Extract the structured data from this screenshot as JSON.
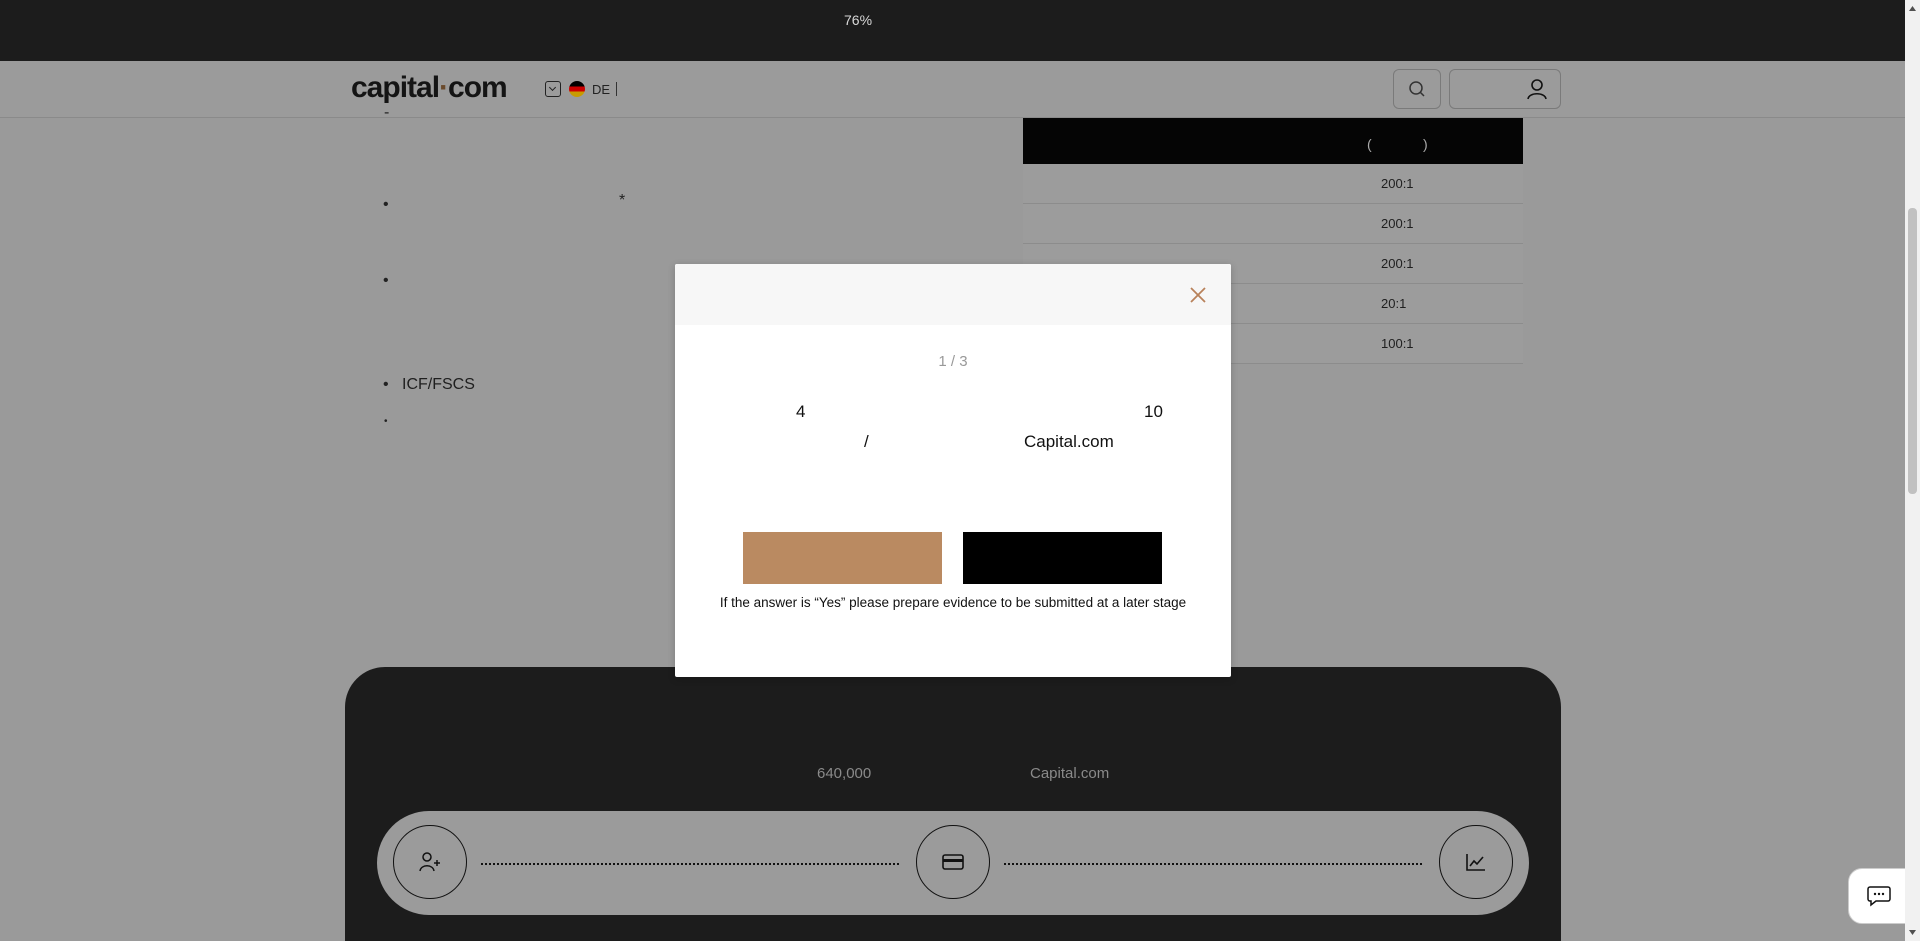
{
  "browser": {
    "zoom_label": "76%"
  },
  "header": {
    "logo_text": "capital",
    "logo_dot": "·",
    "logo_suffix": "com",
    "language_code": "DE",
    "icons": [
      "chevron-down-icon",
      "german-flag-icon",
      "search-icon",
      "user-icon"
    ]
  },
  "content": {
    "bullets": [
      "-",
      "•",
      "*",
      "•",
      "•",
      "•"
    ],
    "icf_label": "ICF/FSCS"
  },
  "leverage_table": {
    "header_open": "(",
    "header_close": ")",
    "rows": [
      "200:1",
      "200:1",
      "200:1",
      "20:1",
      "100:1"
    ]
  },
  "promo": {
    "clients_count": "640,000",
    "brand": "Capital.com",
    "step_icons": [
      "add-user-icon",
      "card-icon",
      "chart-icon"
    ]
  },
  "modal": {
    "step": "1 / 3",
    "question_parts": [
      "4",
      "10",
      "/",
      "Capital.com"
    ],
    "yes_label": "",
    "no_label": "",
    "hint": "If the answer is “Yes” please prepare evidence to be submitted at a later stage",
    "colors": {
      "yes": "#ba8a61",
      "no": "#000000",
      "close": "#b8825a"
    }
  }
}
